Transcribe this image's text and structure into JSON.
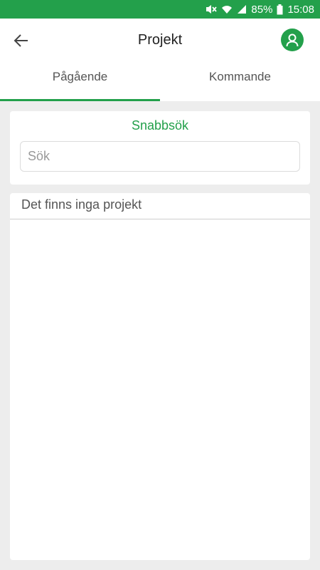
{
  "status_bar": {
    "battery": "85%",
    "time": "15:08",
    "icons": [
      "mute-icon",
      "wifi-icon",
      "signal-icon",
      "battery-icon"
    ]
  },
  "header": {
    "title": "Projekt",
    "back_icon": "arrow-left-icon",
    "profile_icon": "user-icon"
  },
  "tabs": [
    {
      "label": "Pågående",
      "active": true
    },
    {
      "label": "Kommande",
      "active": false
    }
  ],
  "search": {
    "title": "Snabbsök",
    "placeholder": "Sök",
    "value": ""
  },
  "projects": {
    "empty_message": "Det finns inga projekt"
  },
  "colors": {
    "accent": "#23a04b",
    "background": "#ededed"
  }
}
